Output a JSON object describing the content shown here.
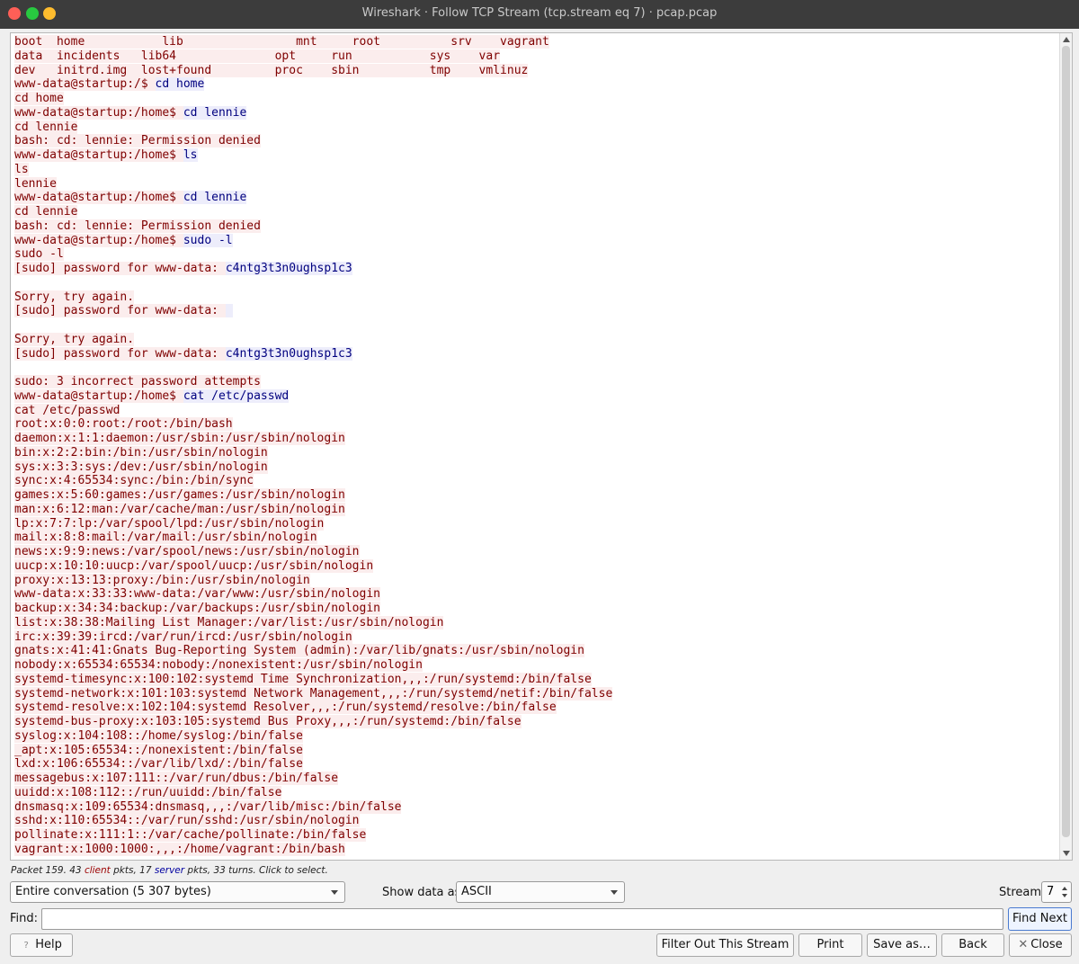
{
  "window": {
    "title": "Wireshark · Follow TCP Stream (tcp.stream eq 7) · pcap.pcap"
  },
  "stream": {
    "lines": [
      {
        "dir": "client",
        "text": "boot  home           lib                mnt     root          srv    vagrant"
      },
      {
        "dir": "client",
        "text": "data  incidents   lib64              opt     run           sys    var"
      },
      {
        "dir": "client",
        "text": "dev   initrd.img  lost+found         proc    sbin          tmp    vmlinuz"
      },
      {
        "dir": "client",
        "text": "www-data@startup:/$ "
      },
      {
        "dir": "client",
        "text": "cd home"
      },
      {
        "dir": "client",
        "text": "www-data@startup:/home$ "
      },
      {
        "dir": "client",
        "text": "cd lennie"
      },
      {
        "dir": "client",
        "text": "bash: cd: lennie: Permission denied"
      },
      {
        "dir": "client",
        "text": "www-data@startup:/home$ "
      },
      {
        "dir": "client",
        "text": "ls"
      },
      {
        "dir": "client",
        "text": "lennie"
      },
      {
        "dir": "client",
        "text": "www-data@startup:/home$ "
      },
      {
        "dir": "client",
        "text": "cd lennie"
      },
      {
        "dir": "client",
        "text": "bash: cd: lennie: Permission denied"
      },
      {
        "dir": "client",
        "text": "www-data@startup:/home$ "
      },
      {
        "dir": "client",
        "text": "sudo -l"
      },
      {
        "dir": "client",
        "text": "[sudo] password for www-data: "
      },
      {
        "dir": "blank",
        "text": ""
      },
      {
        "dir": "client",
        "text": "Sorry, try again."
      },
      {
        "dir": "client",
        "text": "[sudo] password for www-data: "
      },
      {
        "dir": "blank",
        "text": ""
      },
      {
        "dir": "client",
        "text": "Sorry, try again."
      },
      {
        "dir": "client",
        "text": "[sudo] password for www-data: "
      },
      {
        "dir": "blank",
        "text": ""
      },
      {
        "dir": "client",
        "text": "sudo: 3 incorrect password attempts"
      },
      {
        "dir": "client",
        "text": "www-data@startup:/home$ "
      },
      {
        "dir": "client",
        "text": "cat /etc/passwd"
      },
      {
        "dir": "client",
        "text": "root:x:0:0:root:/root:/bin/bash"
      },
      {
        "dir": "client",
        "text": "daemon:x:1:1:daemon:/usr/sbin:/usr/sbin/nologin"
      },
      {
        "dir": "client",
        "text": "bin:x:2:2:bin:/bin:/usr/sbin/nologin"
      },
      {
        "dir": "client",
        "text": "sys:x:3:3:sys:/dev:/usr/sbin/nologin"
      },
      {
        "dir": "client",
        "text": "sync:x:4:65534:sync:/bin:/bin/sync"
      },
      {
        "dir": "client",
        "text": "games:x:5:60:games:/usr/games:/usr/sbin/nologin"
      },
      {
        "dir": "client",
        "text": "man:x:6:12:man:/var/cache/man:/usr/sbin/nologin"
      },
      {
        "dir": "client",
        "text": "lp:x:7:7:lp:/var/spool/lpd:/usr/sbin/nologin"
      },
      {
        "dir": "client",
        "text": "mail:x:8:8:mail:/var/mail:/usr/sbin/nologin"
      },
      {
        "dir": "client",
        "text": "news:x:9:9:news:/var/spool/news:/usr/sbin/nologin"
      },
      {
        "dir": "client",
        "text": "uucp:x:10:10:uucp:/var/spool/uucp:/usr/sbin/nologin"
      },
      {
        "dir": "client",
        "text": "proxy:x:13:13:proxy:/bin:/usr/sbin/nologin"
      },
      {
        "dir": "client",
        "text": "www-data:x:33:33:www-data:/var/www:/usr/sbin/nologin"
      },
      {
        "dir": "client",
        "text": "backup:x:34:34:backup:/var/backups:/usr/sbin/nologin"
      },
      {
        "dir": "client",
        "text": "list:x:38:38:Mailing List Manager:/var/list:/usr/sbin/nologin"
      },
      {
        "dir": "client",
        "text": "irc:x:39:39:ircd:/var/run/ircd:/usr/sbin/nologin"
      },
      {
        "dir": "client",
        "text": "gnats:x:41:41:Gnats Bug-Reporting System (admin):/var/lib/gnats:/usr/sbin/nologin"
      },
      {
        "dir": "client",
        "text": "nobody:x:65534:65534:nobody:/nonexistent:/usr/sbin/nologin"
      },
      {
        "dir": "client",
        "text": "systemd-timesync:x:100:102:systemd Time Synchronization,,,:/run/systemd:/bin/false"
      },
      {
        "dir": "client",
        "text": "systemd-network:x:101:103:systemd Network Management,,,:/run/systemd/netif:/bin/false"
      },
      {
        "dir": "client",
        "text": "systemd-resolve:x:102:104:systemd Resolver,,,:/run/systemd/resolve:/bin/false"
      },
      {
        "dir": "client",
        "text": "systemd-bus-proxy:x:103:105:systemd Bus Proxy,,,:/run/systemd:/bin/false"
      },
      {
        "dir": "client",
        "text": "syslog:x:104:108::/home/syslog:/bin/false"
      },
      {
        "dir": "client",
        "text": "_apt:x:105:65534::/nonexistent:/bin/false"
      },
      {
        "dir": "client",
        "text": "lxd:x:106:65534::/var/lib/lxd/:/bin/false"
      },
      {
        "dir": "client",
        "text": "messagebus:x:107:111::/var/run/dbus:/bin/false"
      },
      {
        "dir": "client",
        "text": "uuidd:x:108:112::/run/uuidd:/bin/false"
      },
      {
        "dir": "client",
        "text": "dnsmasq:x:109:65534:dnsmasq,,,:/var/lib/misc:/bin/false"
      },
      {
        "dir": "client",
        "text": "sshd:x:110:65534::/var/run/sshd:/usr/sbin/nologin"
      },
      {
        "dir": "client",
        "text": "pollinate:x:111:1::/var/cache/pollinate:/bin/false"
      },
      {
        "dir": "client",
        "text": "vagrant:x:1000:1000:,,,:/home/vagrant:/bin/bash"
      }
    ],
    "server_suffix": {
      "3": "cd home",
      "5": "cd lennie",
      "8": "ls",
      "11": "cd lennie",
      "14": "sudo -l",
      "16": "c4ntg3t3n0ughsp1c3",
      "19": " ",
      "22": "c4ntg3t3n0ughsp1c3",
      "25": "cat /etc/passwd"
    }
  },
  "status": {
    "prefix": "Packet 159. 43 ",
    "client_word": "client",
    "middle": " pkts, 17 ",
    "server_word": "server",
    "suffix": " pkts, 33 turns. Click to select."
  },
  "controls": {
    "conversation_select": "Entire conversation (5 307 bytes)",
    "show_data_label": "Show data as",
    "show_data_value": "ASCII",
    "stream_label": "Stream",
    "stream_value": "7",
    "find_label": "Find:",
    "find_value": "",
    "find_next_label": "Find Next"
  },
  "buttons": {
    "help": "Help",
    "filter_out": "Filter Out This Stream",
    "print": "Print",
    "save_as": "Save as…",
    "back": "Back",
    "close": "Close"
  },
  "colors": {
    "client_bg": "#fbeded",
    "client_fg": "#7f0000",
    "server_bg": "#ededfb",
    "server_fg": "#00007f",
    "titlebar": "#3c3c3c"
  }
}
